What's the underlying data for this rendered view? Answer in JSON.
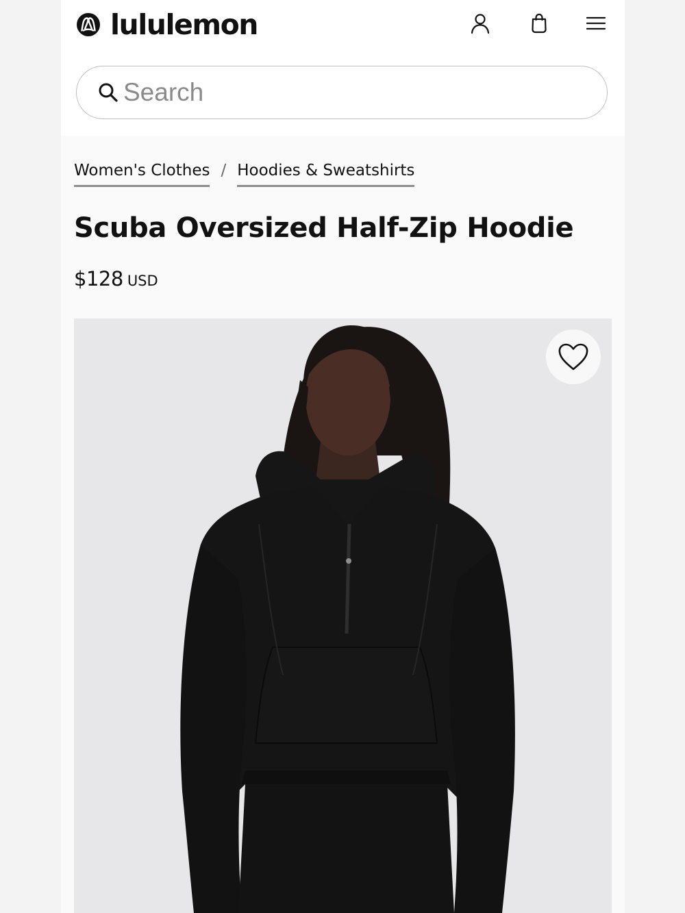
{
  "brand": {
    "name": "lululemon",
    "logo_icon": "lululemon-logo-icon"
  },
  "header": {
    "account_icon": "user-icon",
    "bag_icon": "shopping-bag-icon",
    "menu_icon": "hamburger-menu-icon"
  },
  "search": {
    "placeholder": "Search",
    "value": ""
  },
  "breadcrumb": {
    "items": [
      {
        "label": "Women's Clothes"
      },
      {
        "label": "Hoodies & Sweatshirts"
      }
    ],
    "separator": "/"
  },
  "product": {
    "title": "Scuba Oversized Half-Zip Hoodie",
    "price": "$128",
    "currency": "USD",
    "image_alt": "Model wearing black Scuba Oversized Half-Zip Hoodie",
    "wishlist_icon": "heart-icon"
  },
  "colors": {
    "text": "#111111",
    "page_background": "#fafafa",
    "image_background": "#e8e8ea",
    "garment": "#141414"
  }
}
